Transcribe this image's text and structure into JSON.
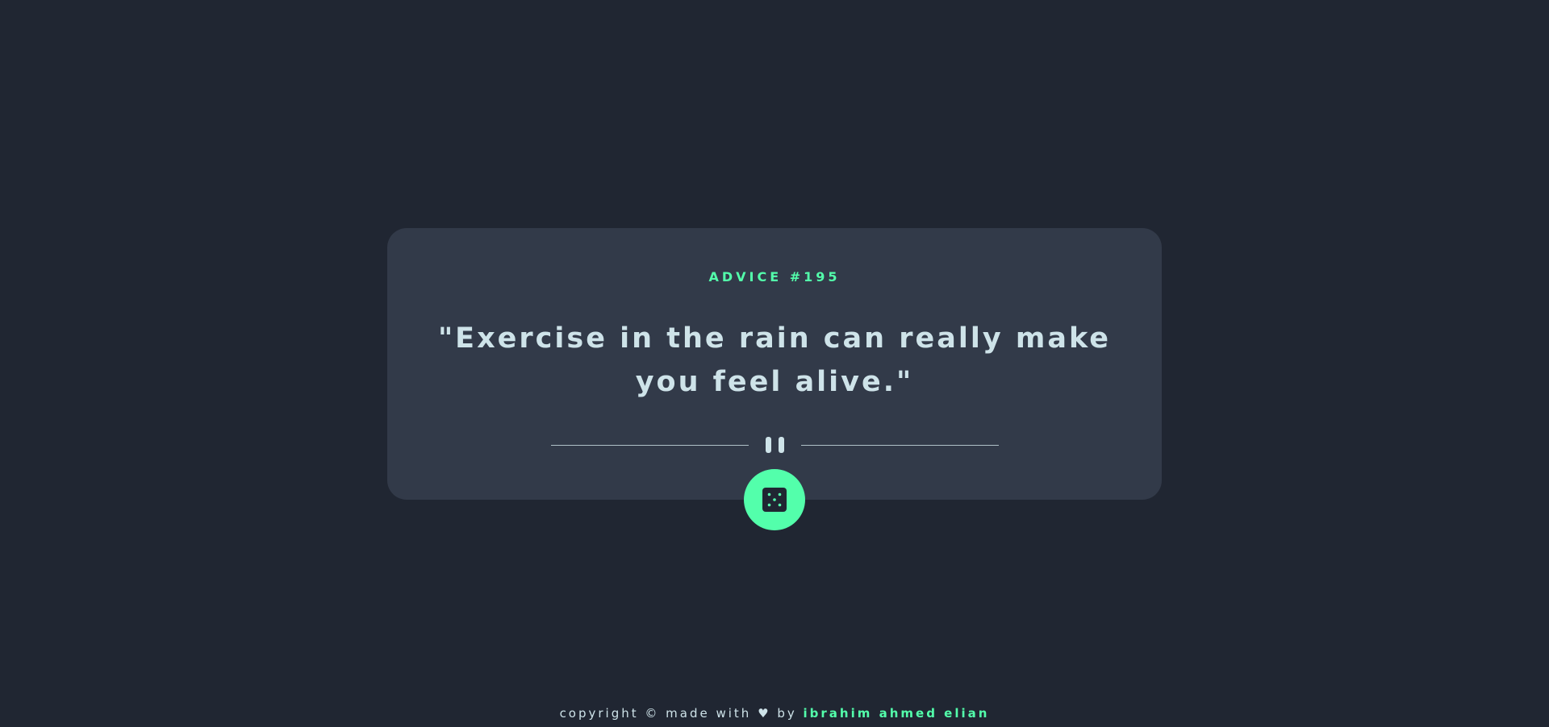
{
  "card": {
    "advice_label": "ADVICE #195",
    "advice_text": "\"Exercise in the rain can really make you feel alive.\""
  },
  "dice_button": {
    "icon": "dice-icon"
  },
  "divider": {
    "icon": "pause-icon"
  },
  "footer": {
    "prefix": "copyright © made with",
    "heart": "♥",
    "by": "by",
    "author": "ibrahim ahmed elian"
  },
  "colors": {
    "background": "#202632",
    "card": "#323a49",
    "accent": "#53ffab",
    "text": "#cee3e9"
  }
}
